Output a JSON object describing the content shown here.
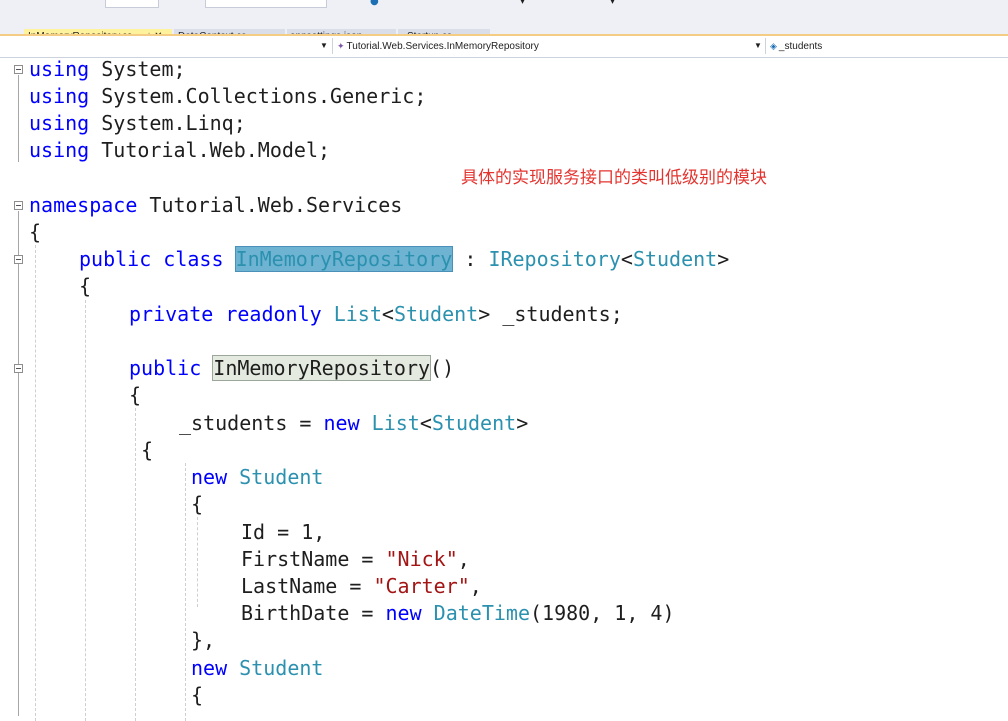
{
  "tabs": [
    {
      "label": "InMemoryRepository.cs",
      "active": true,
      "pin_icon": "pin-icon",
      "close_icon": "close-icon"
    },
    {
      "label": "DataContext.cs",
      "active": false
    },
    {
      "label": "appsettings.json",
      "active": false
    },
    {
      "label": "Startup.cs",
      "active": false
    }
  ],
  "navbar": {
    "namespace_label": "Tutorial.Web.Services.InMemoryRepository",
    "member_label": "_students"
  },
  "code": {
    "line1": {
      "kw": "using",
      "rest": " System;"
    },
    "line2": {
      "kw": "using",
      "rest": " System.Collections.Generic;"
    },
    "line3": {
      "kw": "using",
      "rest": " System.Linq;"
    },
    "line4": {
      "kw": "using",
      "rest": " Tutorial.Web.Model;"
    },
    "line5": {
      "kw": "namespace",
      "rest": " Tutorial.Web.Services"
    },
    "line6": "{",
    "line7": {
      "kw1": "public",
      "kw2": "class",
      "cls": "InMemoryRepository",
      "colon": " : ",
      "iface": "IRepository",
      "lt": "<",
      "arg": "Student",
      "gt": ">"
    },
    "line8": "{",
    "line9": {
      "kw1": "private",
      "kw2": "readonly",
      "ty": "List",
      "lt": "<",
      "arg": "Student",
      "gt": ">",
      "field": " _students;"
    },
    "line10": {
      "kw": "public",
      "ctor": "InMemoryRepository",
      "paren": "()"
    },
    "line11": "{",
    "line12": {
      "lhs": "_students = ",
      "kw": "new",
      "ty": "List",
      "lt": "<",
      "arg": "Student",
      "gt": ">"
    },
    "line13": "{",
    "line14": {
      "kw": "new",
      "ty": "Student"
    },
    "line15": "{",
    "line16": "Id = 1,",
    "line17": {
      "prop": "FirstName = ",
      "str": "\"Nick\"",
      "comma": ","
    },
    "line18": {
      "prop": "LastName = ",
      "str": "\"Carter\"",
      "comma": ","
    },
    "line19": {
      "prop": "BirthDate = ",
      "kw": "new",
      "ty": "DateTime",
      "args": "(1980, 1, 4)"
    },
    "line20": "},",
    "line21": {
      "kw": "new",
      "ty": "Student"
    },
    "line22": "{"
  },
  "annotation": "具体的实现服务接口的类叫低级别的模块",
  "colors": {
    "keyword": "#0000ff",
    "type": "#2b91af",
    "string": "#a31515",
    "annotation": "#e3342f",
    "tab_active": "#fff29d"
  }
}
